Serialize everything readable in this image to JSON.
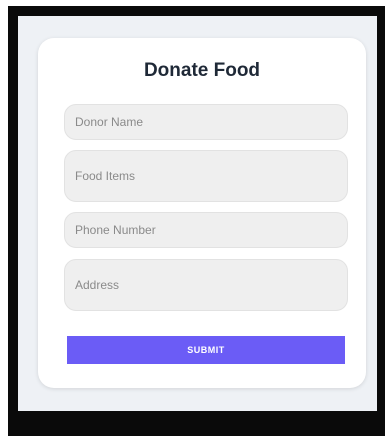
{
  "form": {
    "title": "Donate Food",
    "fields": {
      "donor_name_placeholder": "Donor Name",
      "food_items_placeholder": "Food Items",
      "phone_placeholder": "Phone Number",
      "address_placeholder": "Address"
    },
    "submit_label": "SUBMIT"
  },
  "colors": {
    "accent": "#6b5cf6",
    "background": "#eef1f5",
    "card": "#ffffff"
  }
}
